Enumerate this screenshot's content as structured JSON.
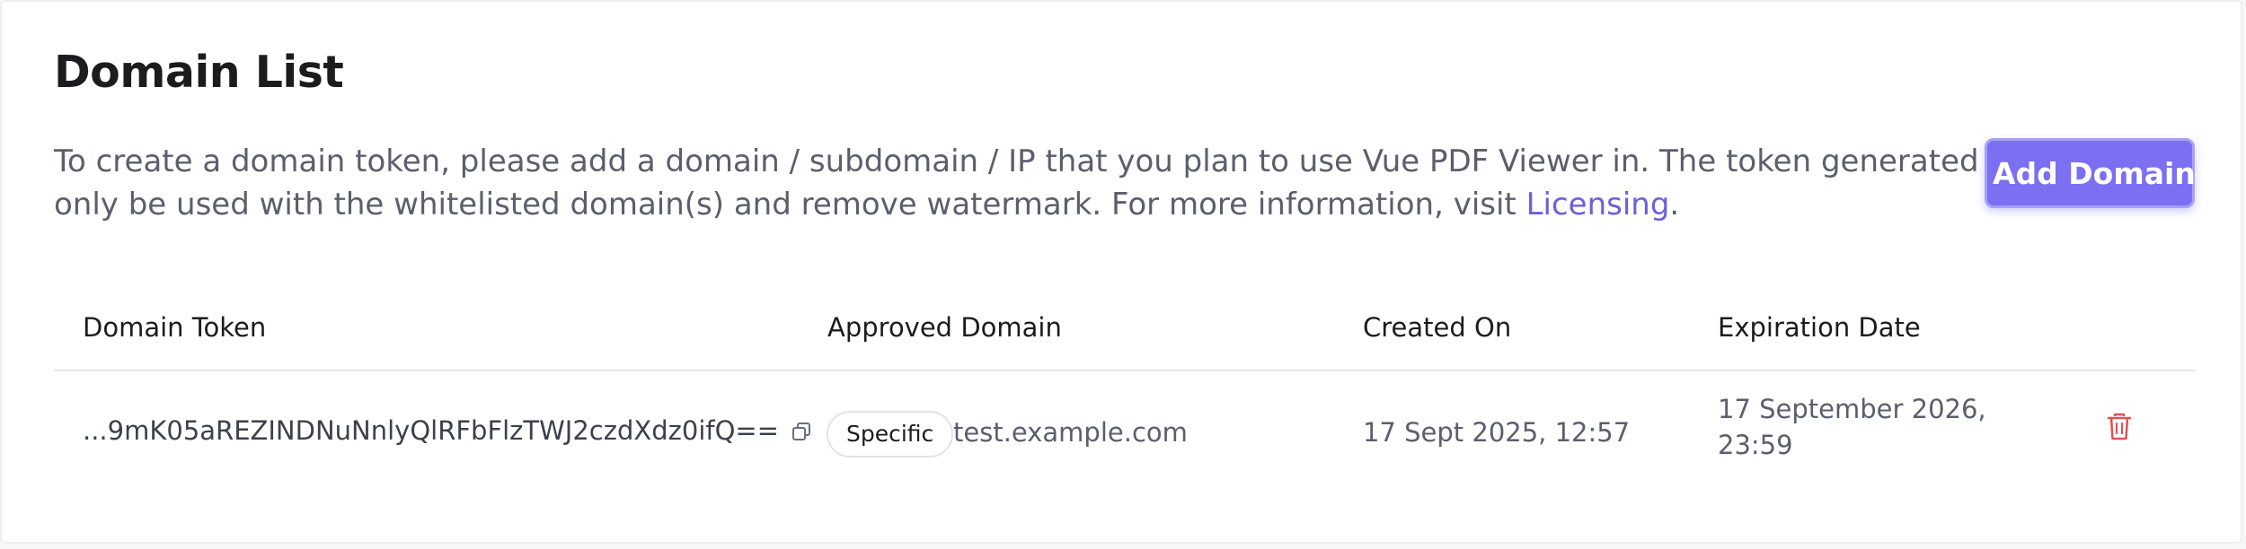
{
  "page": {
    "title": "Domain List",
    "description_line1": "To create a domain token, please add a domain / subdomain / IP that you plan to use Vue PDF Viewer in. The token generated can",
    "description_line2_prefix": "only be used with the whitelisted domain(s) and remove watermark. For more information, visit ",
    "description_link": "Licensing",
    "description_suffix": ".",
    "add_button_label": "Add Domain",
    "accent_color": "#7b6ff2",
    "link_color": "#6a5fe0",
    "danger_color": "#e05252"
  },
  "table": {
    "columns": [
      "Domain Token",
      "Approved Domain",
      "Created On",
      "Expiration Date"
    ],
    "rows": [
      {
        "token": "...9mK05aREZINDNuNnlyQlRFbFlzTWJ2czdXdz0ifQ==",
        "copy_icon": "copy-icon",
        "domain_type": "Specific",
        "domain": "test.example.com",
        "created_on": "17 Sept 2025, 12:57",
        "expiration_date": "17 September 2026, 23:59",
        "delete_icon": "trash-icon"
      }
    ]
  }
}
